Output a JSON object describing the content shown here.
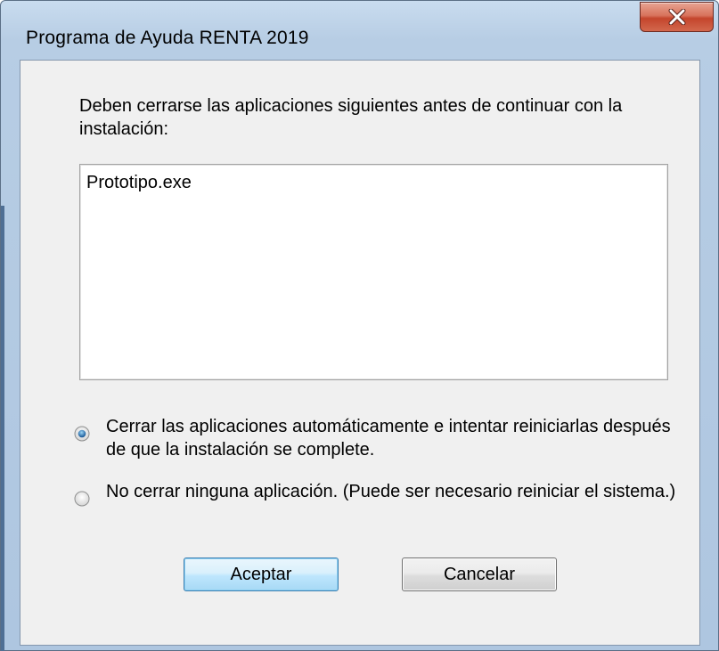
{
  "window": {
    "title": "Programa de Ayuda RENTA 2019"
  },
  "titlebar": {
    "close_icon": "close-icon"
  },
  "dialog": {
    "message": "Deben cerrarse las aplicaciones siguientes antes de continuar con la instalación:",
    "applications": [
      "Prototipo.exe"
    ],
    "options": [
      {
        "label": "Cerrar las aplicaciones automáticamente e intentar reiniciarlas después de que la instalación se complete.",
        "selected": true
      },
      {
        "label": "No cerrar ninguna aplicación. (Puede ser necesario reiniciar el sistema.)",
        "selected": false
      }
    ],
    "buttons": {
      "accept": "Aceptar",
      "cancel": "Cancelar"
    }
  },
  "colors": {
    "frame": "#b7cde4",
    "close_button": "#c4452c",
    "client": "#f0f0f0",
    "default_button_border": "#3c7fb1"
  }
}
